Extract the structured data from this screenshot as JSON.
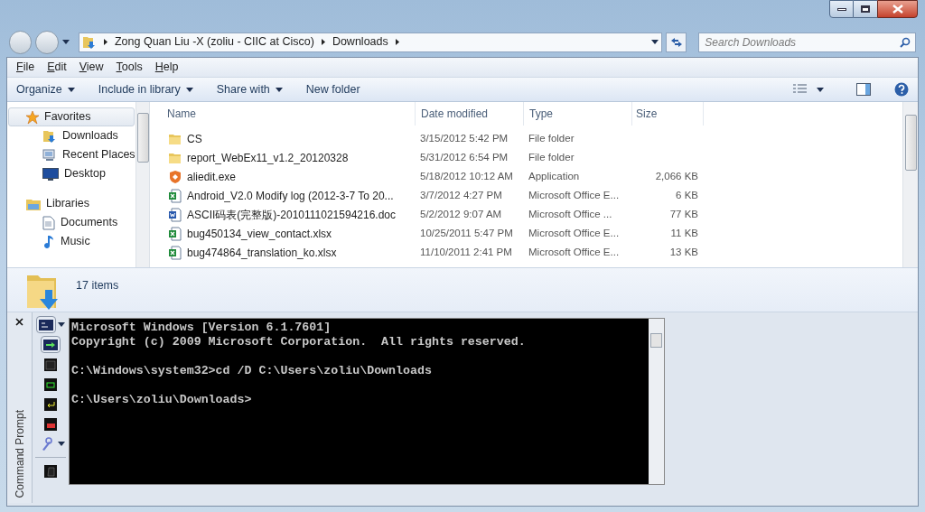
{
  "address": {
    "segments": [
      "Zong Quan Liu -X (zoliu - CIIC at Cisco)",
      "Downloads"
    ]
  },
  "search": {
    "placeholder": "Search Downloads"
  },
  "menu": [
    "File",
    "Edit",
    "View",
    "Tools",
    "Help"
  ],
  "toolbar": [
    {
      "label": "Organize",
      "dropdown": true
    },
    {
      "label": "Include in library",
      "dropdown": true
    },
    {
      "label": "Share with",
      "dropdown": true
    },
    {
      "label": "New folder",
      "dropdown": false
    }
  ],
  "nav": [
    {
      "label": "Favorites",
      "kind": "favorites",
      "selected": true,
      "children": [
        {
          "label": "Downloads",
          "kind": "downloads"
        },
        {
          "label": "Recent Places",
          "kind": "recent"
        },
        {
          "label": "Desktop",
          "kind": "desktop"
        }
      ]
    },
    {
      "label": "Libraries",
      "kind": "libraries",
      "selected": false,
      "children": [
        {
          "label": "Documents",
          "kind": "documents"
        },
        {
          "label": "Music",
          "kind": "music"
        }
      ]
    }
  ],
  "table": {
    "columns": [
      "Name",
      "Date modified",
      "Type",
      "Size"
    ],
    "rows": [
      {
        "kind": "folder",
        "name": "CS",
        "date": "3/15/2012 5:42 PM",
        "type": "File folder"
      },
      {
        "kind": "folder",
        "name": "report_WebEx11_v1.2_20120328",
        "date": "5/31/2012 6:54 PM",
        "type": "File folder"
      },
      {
        "kind": "app",
        "name": "aliedit.exe",
        "date": "5/18/2012 10:12 AM",
        "type": "Application",
        "size": "2,066 KB"
      },
      {
        "kind": "excel",
        "name": "Android_V2.0 Modify log (2012-3-7 To 20...",
        "date": "3/7/2012 4:27 PM",
        "type": "Microsoft Office E...",
        "size": "6 KB"
      },
      {
        "kind": "word",
        "name": "ASCII码表(完整版)-2010111021594216.doc",
        "date": "5/2/2012 9:07 AM",
        "type": "Microsoft Office ...",
        "size": "77 KB"
      },
      {
        "kind": "excel",
        "name": "bug450134_view_contact.xlsx",
        "date": "10/25/2011 5:47 PM",
        "type": "Microsoft Office E...",
        "size": "11 KB"
      },
      {
        "kind": "excel",
        "name": "bug474864_translation_ko.xlsx",
        "date": "11/10/2011 2:41 PM",
        "type": "Microsoft Office E...",
        "size": "13 KB"
      }
    ]
  },
  "details": {
    "count": "17 items"
  },
  "cmd_panel": {
    "title": "Command Prompt",
    "paragraphs": [
      [
        "Microsoft Windows [Version 6.1.7601]",
        "Copyright (c) 2009 Microsoft Corporation.  All rights reserved."
      ],
      [
        "C:\\Windows\\system32>cd /D C:\\Users\\zoliu\\Downloads"
      ],
      [
        "C:\\Users\\zoliu\\Downloads>"
      ]
    ]
  }
}
